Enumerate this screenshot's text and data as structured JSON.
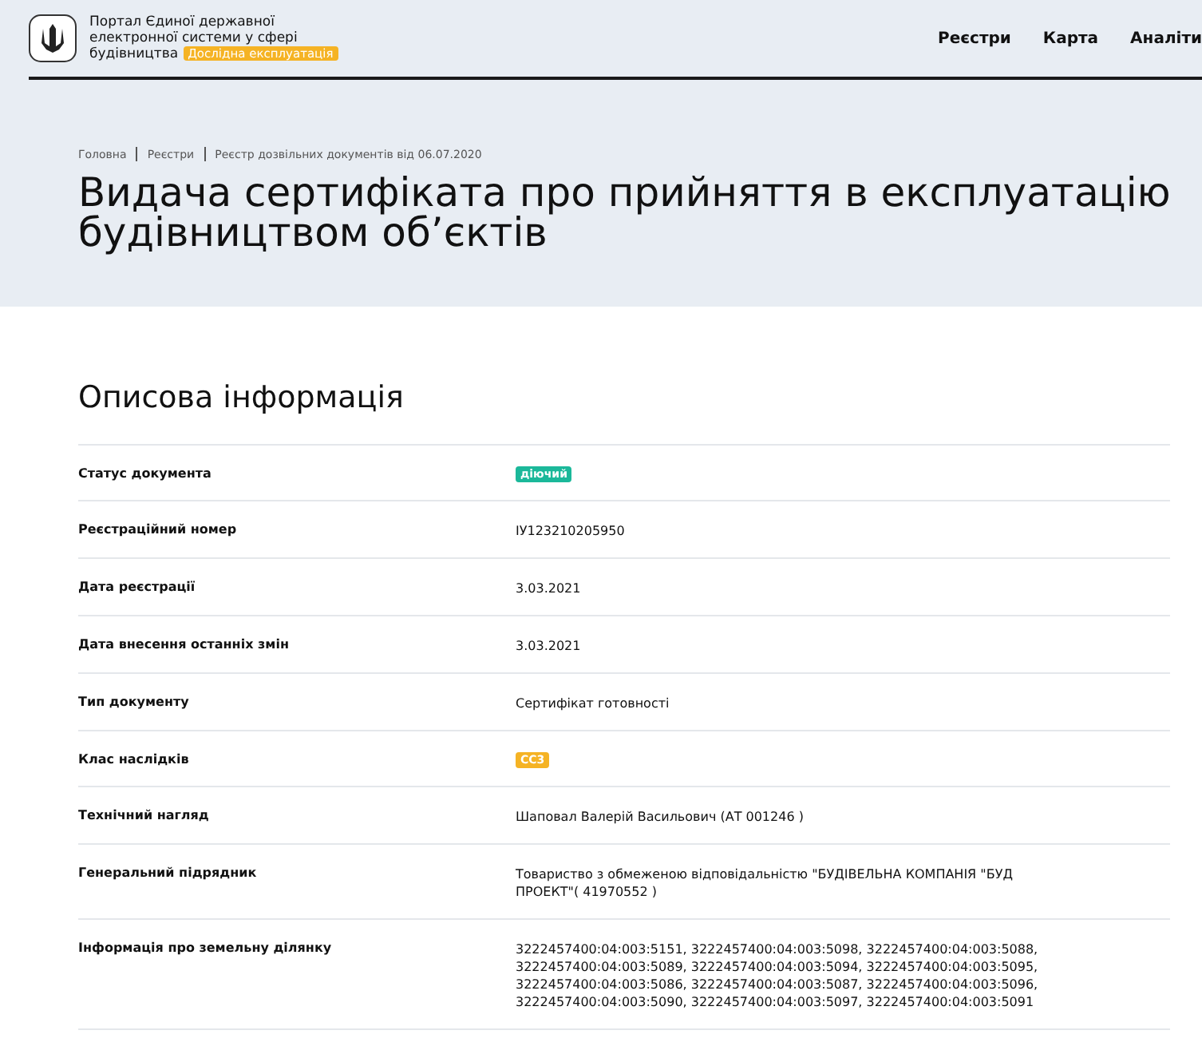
{
  "header": {
    "portal_name": [
      "Портал Єдиної державної",
      "електронної системи у сфері",
      "будівництва"
    ],
    "badge": "Дослідна експлуатація",
    "nav": [
      {
        "label": "Реєстри"
      },
      {
        "label": "Карта"
      },
      {
        "label": "Аналіти"
      }
    ]
  },
  "breadcrumbs": [
    "Головна",
    "Реєстри",
    "Реєстр дозвільних документів від 06.07.2020"
  ],
  "title": [
    "Видача сертифіката про прийняття в експлуатацію",
    "будівництвом об’єктів"
  ],
  "section_title": "Описова інформація",
  "rows": [
    {
      "label": "Статус документа",
      "kind": "badge",
      "value": "діючий",
      "color": "#1bb89a"
    },
    {
      "label": "Реєстраційний номер",
      "kind": "text",
      "value": "ІУ123210205950"
    },
    {
      "label": "Дата реєстрації",
      "kind": "text",
      "value": "3.03.2021"
    },
    {
      "label": "Дата внесення останніх змін",
      "kind": "text",
      "value": "3.03.2021"
    },
    {
      "label": "Тип документу",
      "kind": "text",
      "value": "Сертифікат готовності"
    },
    {
      "label": "Клас наслідків",
      "kind": "badge",
      "value": "СС3",
      "color": "#f5b324"
    },
    {
      "label": "Технічний нагляд",
      "kind": "text",
      "value": "Шаповал Валерій Васильович (АТ 001246 )"
    },
    {
      "label": "Генеральний підрядник",
      "kind": "text",
      "value": "Товариство з обмеженою відповідальністю \"БУДІВЕЛЬНА КОМПАНІЯ \"БУД ПРОЕКТ\"( 41970552 )"
    },
    {
      "label": "Інформація про земельну ділянку",
      "kind": "text",
      "value": "3222457400:04:003:5151, 3222457400:04:003:5098, 3222457400:04:003:5088, 3222457400:04:003:5089, 3222457400:04:003:5094, 3222457400:04:003:5095, 3222457400:04:003:5086, 3222457400:04:003:5087, 3222457400:04:003:5096, 3222457400:04:003:5090, 3222457400:04:003:5097, 3222457400:04:003:5091"
    }
  ]
}
